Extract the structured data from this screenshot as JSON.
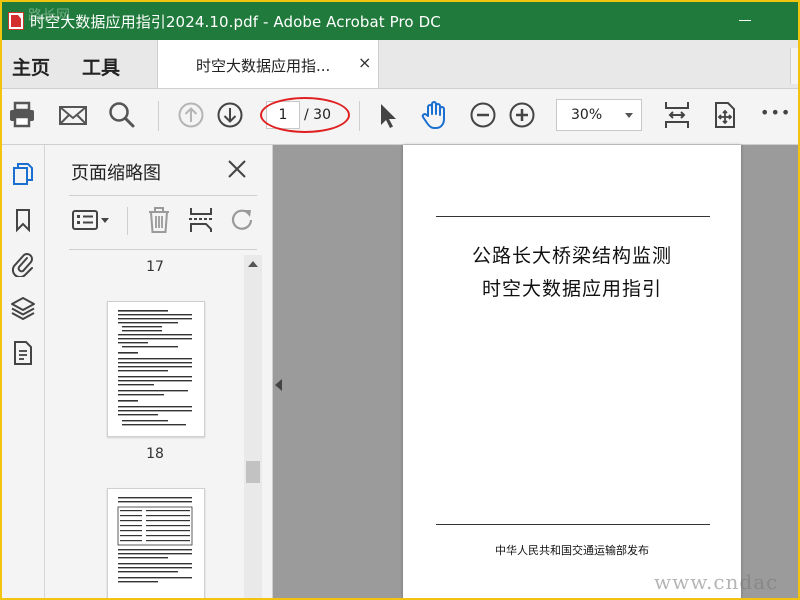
{
  "window": {
    "title": "时空大数据应用指引2024.10.pdf - Adobe Acrobat Pro DC",
    "minimize": "—"
  },
  "nav": {
    "home": "主页",
    "tools": "工具"
  },
  "tab": {
    "label": "时空大数据应用指...",
    "close": "×"
  },
  "toolbar": {
    "current_page": "1",
    "total_pages": "/ 30",
    "zoom": "30%",
    "more": "•••"
  },
  "panel": {
    "title": "页面缩略图",
    "thumbnails": [
      {
        "label": "17"
      },
      {
        "label": "18"
      }
    ]
  },
  "document": {
    "title_line1": "公路长大桥梁结构监测",
    "title_line2": "时空大数据应用指引",
    "issuer": "中华人民共和国交通运输部发布"
  },
  "watermarks": {
    "top_left": "路长网",
    "bottom_right": "www.cndac"
  },
  "colors": {
    "titlebar": "#1f7a3b",
    "accent_blue": "#1a6fd1",
    "annotation_red": "#e02020",
    "outer_border": "#f1c40f"
  },
  "icons": [
    "print-icon",
    "email-icon",
    "search-icon",
    "page-up-icon",
    "page-down-icon",
    "select-cursor-icon",
    "hand-tool-icon",
    "zoom-out-icon",
    "zoom-in-icon",
    "fit-page-icon",
    "rotate-view-icon",
    "more-icon",
    "page-thumbnails-icon",
    "bookmark-icon",
    "attachment-icon",
    "layers-icon",
    "document-properties-icon",
    "close-icon",
    "thumbnail-options-icon",
    "delete-icon",
    "insert-page-icon",
    "rotate-page-icon"
  ]
}
